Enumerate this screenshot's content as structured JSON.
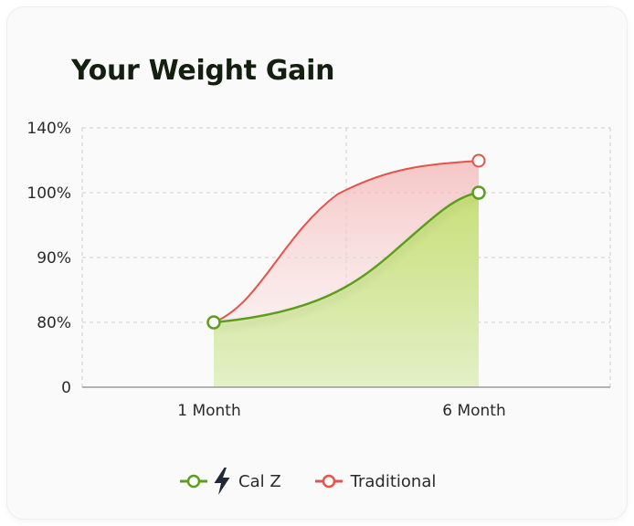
{
  "title": "Your Weight Gain",
  "colors": {
    "calz": "#5c9e1f",
    "traditional": "#e5534b",
    "calz_fill": "#cfe38a",
    "traditional_fill": "#f6cccc",
    "grid": "#cccccc",
    "axis": "#9a9a9a"
  },
  "legend": {
    "calz_icon": "lightning-bolt-icon",
    "calz_label": "Cal Z",
    "traditional_label": "Traditional"
  },
  "chart_data": {
    "type": "area",
    "title": "Your Weight Gain",
    "xlabel": "",
    "ylabel": "",
    "x_ticks": [
      "1 Month",
      "6 Month"
    ],
    "y_ticks": [
      "0",
      "80%",
      "90%",
      "100%",
      "140%"
    ],
    "grid": true,
    "legend_position": "bottom",
    "series": [
      {
        "name": "Cal Z",
        "values": [
          "80%",
          "100%"
        ]
      },
      {
        "name": "Traditional",
        "values": [
          "80%",
          "~120%"
        ]
      }
    ]
  }
}
